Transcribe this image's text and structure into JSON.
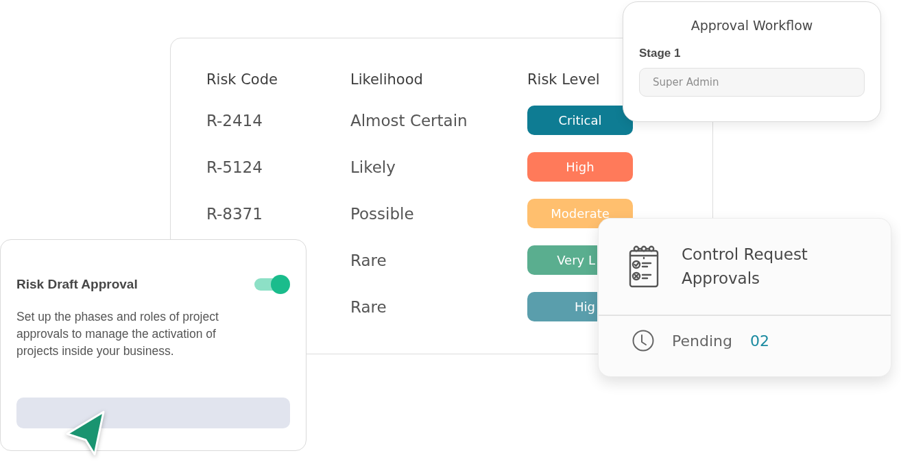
{
  "risk_table": {
    "columns": [
      "Risk Code",
      "Likelihood",
      "Risk Level"
    ],
    "rows": [
      {
        "code": "R-2414",
        "likelihood": "Almost Certain",
        "level": {
          "label": "Critical",
          "color": "#0e7c93",
          "clipped": false
        }
      },
      {
        "code": "R-5124",
        "likelihood": "Likely",
        "level": {
          "label": "High",
          "color": "#ff7a5a",
          "clipped": false
        }
      },
      {
        "code": "R-8371",
        "likelihood": "Possible",
        "level": {
          "label": "Moderate",
          "color": "#ffbf6e",
          "clipped": false
        }
      },
      {
        "likelihood": "Rare",
        "level": {
          "label": "Very L",
          "color": "#5aae8f",
          "clipped": true
        }
      },
      {
        "likelihood": "Rare",
        "level": {
          "label": "Hig",
          "color": "#5a9eac",
          "clipped": true
        }
      }
    ]
  },
  "workflow_card": {
    "title": "Approval Workflow",
    "stage_label": "Stage 1",
    "field": {
      "placeholder": "Super Admin"
    }
  },
  "approval_card": {
    "title": "Risk Draft Approval",
    "toggle": {
      "on": true
    },
    "description": "Set up the phases and roles of project approvals to manage the activation of projects inside your business."
  },
  "requests_card": {
    "title": "Control Request Approvals",
    "status_label": "Pending",
    "count": "02"
  }
}
